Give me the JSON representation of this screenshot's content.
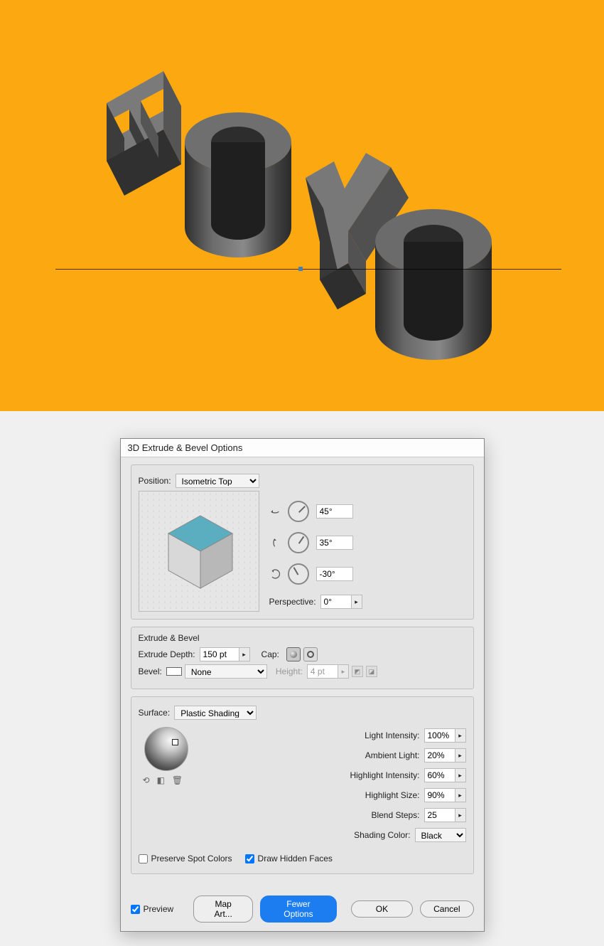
{
  "canvas": {
    "art_text": "HOYO"
  },
  "dialog": {
    "title": "3D Extrude & Bevel Options",
    "position_label": "Position:",
    "position_value": "Isometric Top",
    "rot_x": "45°",
    "rot_y": "35°",
    "rot_z": "-30°",
    "perspective_label": "Perspective:",
    "perspective_value": "0°",
    "extrude_section": "Extrude & Bevel",
    "extrude_depth_label": "Extrude Depth:",
    "extrude_depth_value": "150 pt",
    "cap_label": "Cap:",
    "bevel_label": "Bevel:",
    "bevel_value": "None",
    "height_label": "Height:",
    "height_value": "4 pt",
    "surface_label": "Surface:",
    "surface_value": "Plastic Shading",
    "light_intensity_label": "Light Intensity:",
    "light_intensity_value": "100%",
    "ambient_light_label": "Ambient Light:",
    "ambient_light_value": "20%",
    "highlight_intensity_label": "Highlight Intensity:",
    "highlight_intensity_value": "60%",
    "highlight_size_label": "Highlight Size:",
    "highlight_size_value": "90%",
    "blend_steps_label": "Blend Steps:",
    "blend_steps_value": "25",
    "shading_color_label": "Shading Color:",
    "shading_color_value": "Black",
    "preserve_spot_label": "Preserve Spot Colors",
    "draw_hidden_label": "Draw Hidden Faces",
    "preview_label": "Preview",
    "map_art_btn": "Map Art...",
    "fewer_options_btn": "Fewer Options",
    "ok_btn": "OK",
    "cancel_btn": "Cancel"
  }
}
